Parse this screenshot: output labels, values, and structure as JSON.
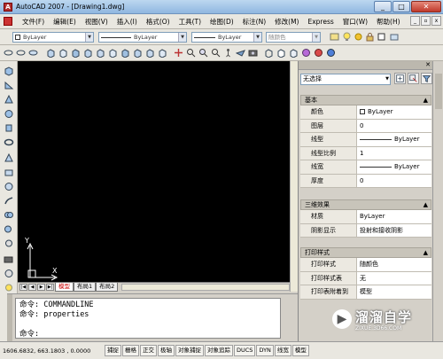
{
  "window": {
    "title": "AutoCAD 2007 - [Drawing1.dwg]",
    "min": "_",
    "max": "□",
    "close": "✕"
  },
  "menu": [
    "文件(F)",
    "编辑(E)",
    "视图(V)",
    "插入(I)",
    "格式(O)",
    "工具(T)",
    "绘图(D)",
    "标注(N)",
    "修改(M)",
    "Express",
    "窗口(W)",
    "帮助(H)"
  ],
  "props_toolbar": {
    "layer": "ByLayer",
    "linetype": "ByLayer",
    "lineweight": "ByLayer",
    "plotstyle": "随颜色"
  },
  "layout_tabs": {
    "model": "模型",
    "layout1": "布局1",
    "layout2": "布局2"
  },
  "nav_arrows": [
    "|◀",
    "◀",
    "▶",
    "▶|"
  ],
  "ucs": {
    "x": "X",
    "y": "Y"
  },
  "command": {
    "lines": [
      {
        "prompt": "命令:",
        "text": "COMMANDLINE"
      },
      {
        "prompt": "命令:",
        "text": "properties"
      }
    ],
    "current_prompt": "命令:"
  },
  "status": {
    "coords": "1606.6832, 663.1803 , 0.0000",
    "buttons": [
      "捕捉",
      "栅格",
      "正交",
      "极轴",
      "对象捕捉",
      "对象追踪",
      "DUCS",
      "DYN",
      "线宽",
      "模型"
    ]
  },
  "palette": {
    "selection": "无选择",
    "sections": [
      {
        "title": "基本",
        "rows": [
          {
            "label": "颜色",
            "value": "ByLayer",
            "kind": "color"
          },
          {
            "label": "图层",
            "value": "0",
            "kind": "text"
          },
          {
            "label": "线型",
            "value": "ByLayer",
            "kind": "line"
          },
          {
            "label": "线型比例",
            "value": "1",
            "kind": "text"
          },
          {
            "label": "线宽",
            "value": "ByLayer",
            "kind": "line"
          },
          {
            "label": "厚度",
            "value": "0",
            "kind": "text"
          }
        ]
      },
      {
        "title": "三维效果",
        "rows": [
          {
            "label": "材质",
            "value": "ByLayer",
            "kind": "text"
          },
          {
            "label": "阴影显示",
            "value": "投射和接收阴影",
            "kind": "text"
          }
        ]
      },
      {
        "title": "打印样式",
        "rows": [
          {
            "label": "打印样式",
            "value": "随颜色",
            "kind": "text"
          },
          {
            "label": "打印样式表",
            "value": "无",
            "kind": "text"
          },
          {
            "label": "打印表附着到",
            "value": "模型",
            "kind": "text"
          }
        ]
      }
    ]
  },
  "watermark": {
    "name": "溜溜自学",
    "url": "ZIXUE.3D66.COM"
  },
  "colors": {
    "canvas": "#000000",
    "chrome": "#d4d0c8",
    "titlebar": "#8fb7e0",
    "active_tab": "#cc0000"
  }
}
